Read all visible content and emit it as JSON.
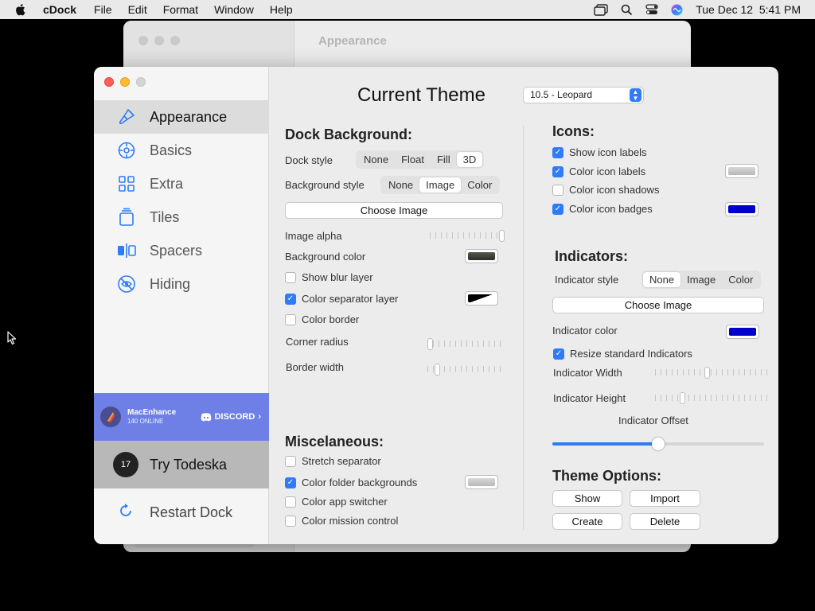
{
  "menubar": {
    "app_name": "cDock",
    "menus": [
      "File",
      "Edit",
      "Format",
      "Window",
      "Help"
    ],
    "datetime": "Tue Dec 12  5:41 PM"
  },
  "background_window": {
    "title": "Appearance"
  },
  "sidebar": {
    "items": [
      {
        "label": "Appearance",
        "icon": "brush-icon",
        "active": true
      },
      {
        "label": "Basics",
        "icon": "gear-icon",
        "active": false
      },
      {
        "label": "Extra",
        "icon": "grid-icon",
        "active": false
      },
      {
        "label": "Tiles",
        "icon": "tiles-icon",
        "active": false
      },
      {
        "label": "Spacers",
        "icon": "spacer-icon",
        "active": false
      },
      {
        "label": "Hiding",
        "icon": "eye-slash-icon",
        "active": false
      }
    ],
    "promo": {
      "name": "MacEnhance",
      "online": "140 ONLINE",
      "discord": "DISCORD"
    },
    "todeska": {
      "label": "Try Todeska",
      "icon_text": "17"
    },
    "restart": {
      "label": "Restart Dock"
    }
  },
  "content": {
    "title": "Current Theme",
    "theme_select": "10.5 - Leopard",
    "dock_background": {
      "heading": "Dock Background:",
      "dock_style_label": "Dock style",
      "dock_style_options": [
        "None",
        "Float",
        "Fill",
        "3D"
      ],
      "dock_style_selected": "3D",
      "bg_style_label": "Background style",
      "bg_style_options": [
        "None",
        "Image",
        "Color"
      ],
      "bg_style_selected": "Image",
      "choose_image": "Choose Image",
      "image_alpha_label": "Image alpha",
      "image_alpha_value": 1.0,
      "bg_color_label": "Background color",
      "show_blur": {
        "label": "Show blur layer",
        "checked": false
      },
      "color_separator": {
        "label": "Color separator layer",
        "checked": true
      },
      "color_border": {
        "label": "Color border",
        "checked": false
      },
      "corner_radius_label": "Corner radius",
      "corner_radius_value": 0.0,
      "border_width_label": "Border width",
      "border_width_value": 0.1
    },
    "misc": {
      "heading": "Miscelaneous:",
      "stretch_separator": {
        "label": "Stretch separator",
        "checked": false
      },
      "color_folder_bg": {
        "label": "Color folder backgrounds",
        "checked": true
      },
      "color_app_switcher": {
        "label": "Color app switcher",
        "checked": false
      },
      "color_mission_control": {
        "label": "Color mission control",
        "checked": false
      }
    },
    "icons": {
      "heading": "Icons:",
      "show_labels": {
        "label": "Show icon labels",
        "checked": true
      },
      "color_labels": {
        "label": "Color icon labels",
        "checked": true
      },
      "color_shadows": {
        "label": "Color icon shadows",
        "checked": false
      },
      "color_badges": {
        "label": "Color icon badges",
        "checked": true
      }
    },
    "indicators": {
      "heading": "Indicators:",
      "style_label": "Indicator style",
      "style_options": [
        "None",
        "Image",
        "Color"
      ],
      "style_selected": "None",
      "choose_image": "Choose Image",
      "color_label": "Indicator color",
      "resize": {
        "label": "Resize standard Indicators",
        "checked": true
      },
      "width_label": "Indicator Width",
      "width_value": 0.46,
      "height_label": "Indicator Height",
      "height_value": 0.23,
      "offset_label": "Indicator Offset",
      "offset_value": 0.5
    },
    "theme_options": {
      "heading": "Theme Options:",
      "buttons": [
        "Show",
        "Import",
        "Create",
        "Delete"
      ]
    }
  },
  "colors": {
    "accent": "#2f7cf6",
    "bg_color_swatch": "#3a3d34",
    "label_color_swatch": "#c8c8c8",
    "badge_color_swatch": "#0000cc",
    "indicator_color_swatch": "#0000cc",
    "folder_color_swatch": "#c8c8c8"
  }
}
